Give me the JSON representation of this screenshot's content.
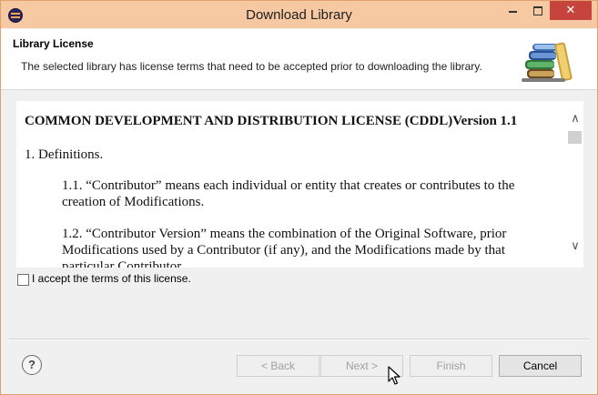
{
  "window": {
    "title": "Download Library",
    "controls": {
      "minimize": "minimize-icon",
      "maximize": "maximize-icon",
      "close": "✕"
    }
  },
  "header": {
    "title": "Library License",
    "description": "The selected library has license terms that need to be accepted prior to downloading the library.",
    "icon": "library-books-icon"
  },
  "license": {
    "title": "COMMON DEVELOPMENT AND DISTRIBUTION LICENSE (CDDL)Version 1.1",
    "section_heading": "1. Definitions.",
    "paragraphs": [
      "1.1. “Contributor” means each individual or entity that creates or contributes to the creation of Modifications.",
      "1.2. “Contributor Version” means the combination of the Original Software, prior Modifications used by a Contributor (if any), and the Modifications made by that particular Contributor."
    ]
  },
  "accept": {
    "label": "I accept the terms of this license.",
    "checked": false
  },
  "buttons": {
    "help": "?",
    "back": "< Back",
    "next": "Next >",
    "finish": "Finish",
    "cancel": "Cancel"
  },
  "colors": {
    "titlebar": "#f6c9a3",
    "close_button": "#c7433d",
    "window_bg": "#f0f0f0"
  }
}
